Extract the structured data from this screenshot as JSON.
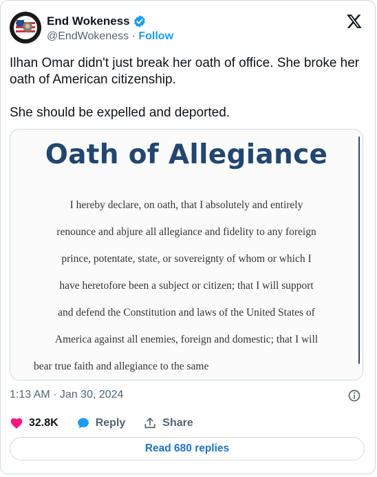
{
  "author": {
    "name": "End Wokeness",
    "handle": "@EndWokeness",
    "separator": "·",
    "follow_label": "Follow"
  },
  "tweet": {
    "paragraphs": [
      "Ilhan Omar didn't just break her oath of office. She broke her oath of American citizenship.",
      "She should be expelled and deported."
    ]
  },
  "media": {
    "title": "Oath of Allegiance",
    "lines": [
      "I hereby declare, on oath, that I absolutely and entirely",
      "renounce and abjure all allegiance and fidelity to any foreign",
      "prince, potentate, state, or sovereignty of whom or which I",
      "have heretofore been a subject or citizen; that I will support",
      "and defend the Constitution and laws of the United States of",
      "America against all enemies, foreign and domestic; that I will",
      "bear true faith and allegiance to the same"
    ]
  },
  "timestamp": "1:13 AM · Jan 30, 2024",
  "actions": {
    "like_count": "32.8K",
    "reply_label": "Reply",
    "share_label": "Share"
  },
  "read_replies_label": "Read 680 replies",
  "colors": {
    "accent": "#1d9bf0",
    "like": "#f91880",
    "title": "#22466f"
  },
  "icons": [
    "verified-badge-icon",
    "x-logo-icon",
    "info-icon",
    "heart-icon",
    "reply-bubble-icon",
    "share-icon"
  ]
}
